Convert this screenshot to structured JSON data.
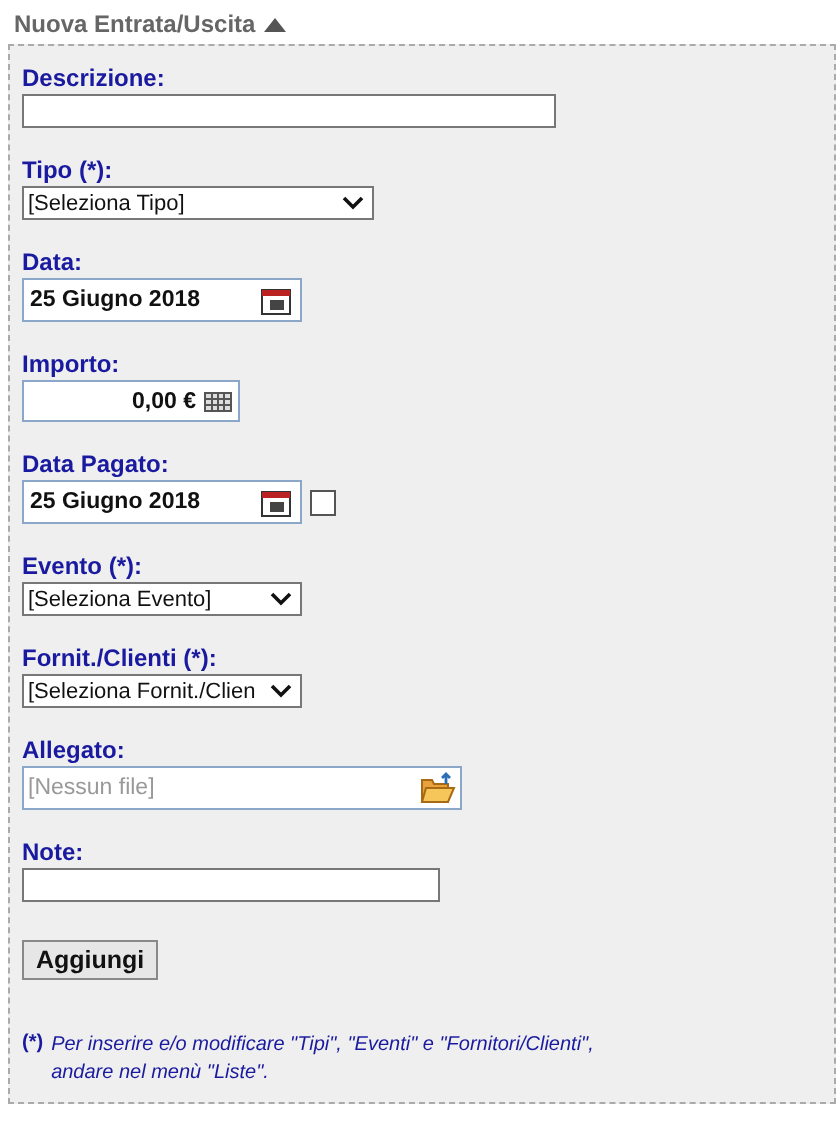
{
  "header": {
    "title": "Nuova Entrata/Uscita",
    "expanded": true
  },
  "fields": [
    {
      "kind": "text",
      "label": "Descrizione:"
    },
    {
      "kind": "select",
      "label": "Tipo (*):",
      "value": "[Seleziona Tipo]"
    },
    {
      "kind": "date",
      "label": "Data:",
      "value": "25 Giugno 2018"
    },
    {
      "kind": "amount",
      "label": "Importo:",
      "value": "0,00 €"
    },
    {
      "kind": "date",
      "label": "Data Pagato:",
      "value": "25 Giugno 2018",
      "checked": false
    },
    {
      "kind": "select",
      "label": "Evento (*):",
      "value": "[Seleziona Evento]"
    },
    {
      "kind": "select",
      "label": "Fornit./Clienti (*):",
      "value": "[Seleziona Fornit./Clien"
    },
    {
      "kind": "file",
      "label": "Allegato:",
      "placeholder": "[Nessun file]"
    },
    {
      "kind": "text",
      "label": "Note:"
    }
  ],
  "submit": "Aggiungi",
  "footnote": {
    "marker": "(*)",
    "lines": [
      "Per inserire e/o modificare \"Tipi\", \"Eventi\" e \"Fornitori/Clienti\",",
      "andare nel menù \"Liste\"."
    ]
  }
}
